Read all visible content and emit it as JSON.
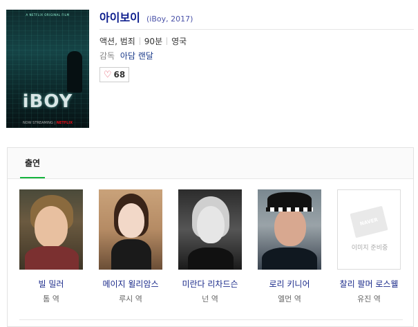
{
  "movie": {
    "title": "아이보이",
    "subtitle": "(iBoy, 2017)",
    "genre": "액션, 범죄",
    "runtime": "90분",
    "country": "영국",
    "director_label": "감독",
    "director": "아담 랜달",
    "like_count": "68"
  },
  "poster": {
    "tagline": "A NETFLIX ORIGINAL FILM",
    "title_text": "iBOY",
    "footer_now": "NOW STREAMING",
    "footer_brand": "NETFLIX"
  },
  "cast_tab": {
    "label": "출연"
  },
  "cast": [
    {
      "name": "빌 밀러",
      "role": "톰 역"
    },
    {
      "name": "메이지 윌리암스",
      "role": "루시 역"
    },
    {
      "name": "미란다 리차드슨",
      "role": "넌 역"
    },
    {
      "name": "로리 키니어",
      "role": "엘먼 역"
    },
    {
      "name": "찰리 팔머 로스웰",
      "role": "유진 역"
    }
  ],
  "no_image": {
    "badge": "NAVER",
    "text": "이미지 준비중"
  },
  "colors": {
    "link": "#1a2a8a",
    "tab_underline": "#13b33b",
    "heart": "#e0475a"
  }
}
